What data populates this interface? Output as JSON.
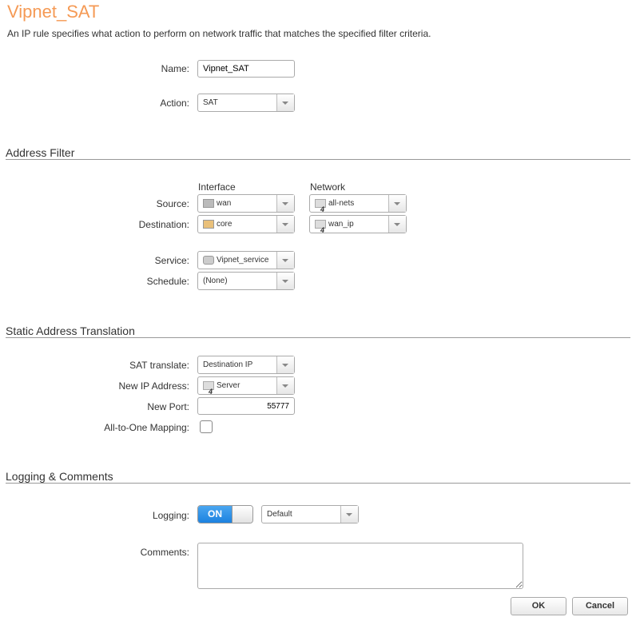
{
  "title": "Vipnet_SAT",
  "description": "An IP rule specifies what action to perform on network traffic that matches the specified filter criteria.",
  "general": {
    "name_label": "Name:",
    "name_value": "Vipnet_SAT",
    "action_label": "Action:",
    "action_value": "SAT"
  },
  "address_filter": {
    "heading": "Address Filter",
    "interface_header": "Interface",
    "network_header": "Network",
    "source_label": "Source:",
    "source_interface": "wan",
    "source_network": "all-nets",
    "destination_label": "Destination:",
    "destination_interface": "core",
    "destination_network": "wan_ip",
    "service_label": "Service:",
    "service_value": "Vipnet_service",
    "schedule_label": "Schedule:",
    "schedule_value": "(None)"
  },
  "sat": {
    "heading": "Static Address Translation",
    "translate_label": "SAT translate:",
    "translate_value": "Destination IP",
    "new_ip_label": "New IP Address:",
    "new_ip_value": "Server",
    "new_port_label": "New Port:",
    "new_port_value": "55777",
    "all_to_one_label": "All-to-One Mapping:"
  },
  "logging": {
    "heading": "Logging & Comments",
    "logging_label": "Logging:",
    "toggle_label": "ON",
    "log_level": "Default",
    "comments_label": "Comments:",
    "comments_value": ""
  },
  "buttons": {
    "ok": "OK",
    "cancel": "Cancel"
  }
}
